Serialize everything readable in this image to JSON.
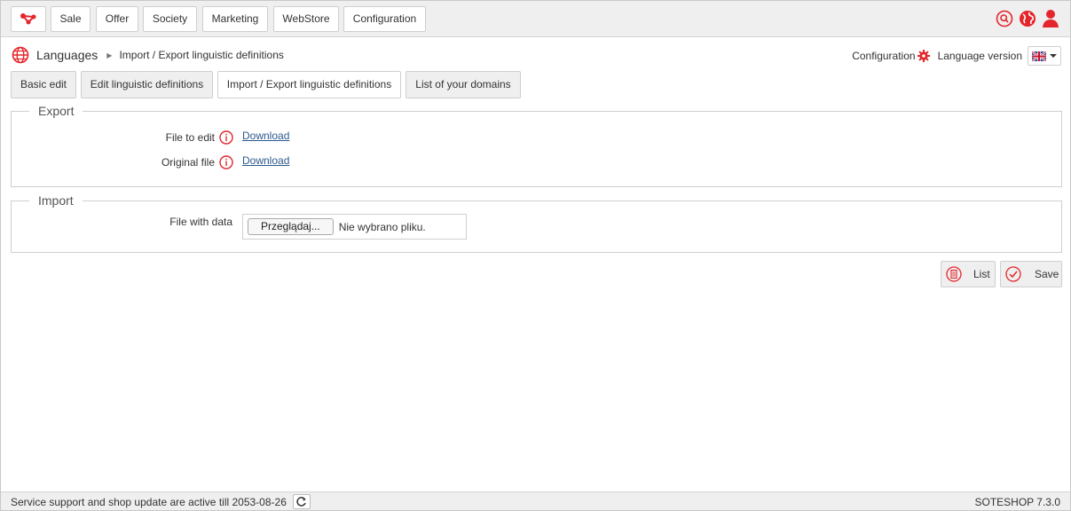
{
  "topnav": {
    "items": [
      "Sale",
      "Offer",
      "Society",
      "Marketing",
      "WebStore",
      "Configuration"
    ]
  },
  "header_icons": [
    "search-icon",
    "globe-icon",
    "user-icon"
  ],
  "breadcrumb": {
    "section": "Languages",
    "current": "Import / Export linguistic definitions"
  },
  "toolbar": {
    "configuration_label": "Configuration",
    "language_version_label": "Language version",
    "flag_icon": "uk-flag-icon"
  },
  "tabs": [
    {
      "label": "Basic edit",
      "active": false
    },
    {
      "label": "Edit linguistic definitions",
      "active": false
    },
    {
      "label": "Import / Export linguistic definitions",
      "active": true
    },
    {
      "label": "List of your domains",
      "active": false
    }
  ],
  "export": {
    "legend": "Export",
    "rows": [
      {
        "label": "File to edit",
        "link": "Download"
      },
      {
        "label": "Original file",
        "link": "Download"
      }
    ]
  },
  "import": {
    "legend": "Import",
    "field_label": "File with data",
    "browse_button": "Przeglądaj...",
    "file_status": "Nie wybrano pliku."
  },
  "actions": {
    "list_label": "List",
    "save_label": "Save"
  },
  "footer": {
    "support_text": "Service support and shop update are active till 2053-08-26",
    "version": "SOTESHOP 7.3.0"
  },
  "colors": {
    "accent": "#e4262c",
    "link": "#2c5a8e"
  }
}
